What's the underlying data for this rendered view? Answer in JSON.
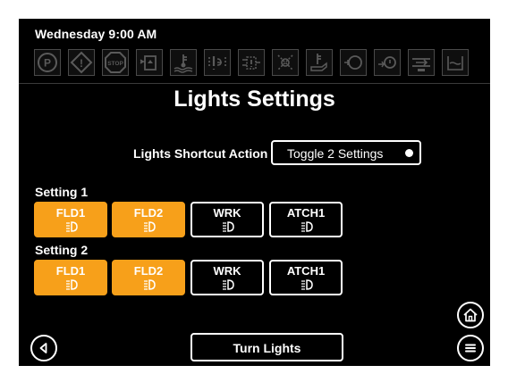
{
  "status": {
    "datetime": "Wednesday 9:00 AM"
  },
  "indicators": [
    {
      "icon": "parking-brake-icon",
      "text": "P"
    },
    {
      "icon": "warning-icon",
      "text": "!"
    },
    {
      "icon": "stop-icon",
      "text": "STOP"
    },
    {
      "icon": "fuel-filter-icon"
    },
    {
      "icon": "coolant-temperature-icon"
    },
    {
      "icon": "transmission-warning-icon"
    },
    {
      "icon": "hydraulic-warning-icon"
    },
    {
      "icon": "differential-lock-icon"
    },
    {
      "icon": "engine-oil-temperature-icon"
    },
    {
      "icon": "engine-check-icon"
    },
    {
      "icon": "oil-pressure-icon"
    },
    {
      "icon": "battery-charge-icon"
    },
    {
      "icon": "water-in-fuel-icon"
    }
  ],
  "page": {
    "title": "Lights Settings"
  },
  "shortcut": {
    "label": "Lights Shortcut Action",
    "value": "Toggle 2 Settings"
  },
  "setting1": {
    "label": "Setting 1",
    "buttons": [
      {
        "label": "FLD1",
        "active": true
      },
      {
        "label": "FLD2",
        "active": true
      },
      {
        "label": "WRK",
        "active": false
      },
      {
        "label": "ATCH1",
        "active": false
      }
    ]
  },
  "setting2": {
    "label": "Setting 2",
    "buttons": [
      {
        "label": "FLD1",
        "active": true
      },
      {
        "label": "FLD2",
        "active": true
      },
      {
        "label": "WRK",
        "active": false
      },
      {
        "label": "ATCH1",
        "active": false
      }
    ]
  },
  "footer": {
    "turn_lights_label": "Turn Lights"
  },
  "colors": {
    "accent": "#f7a01a",
    "background": "#000000",
    "text": "#ffffff",
    "indicator_idle": "#4a4a4a"
  }
}
